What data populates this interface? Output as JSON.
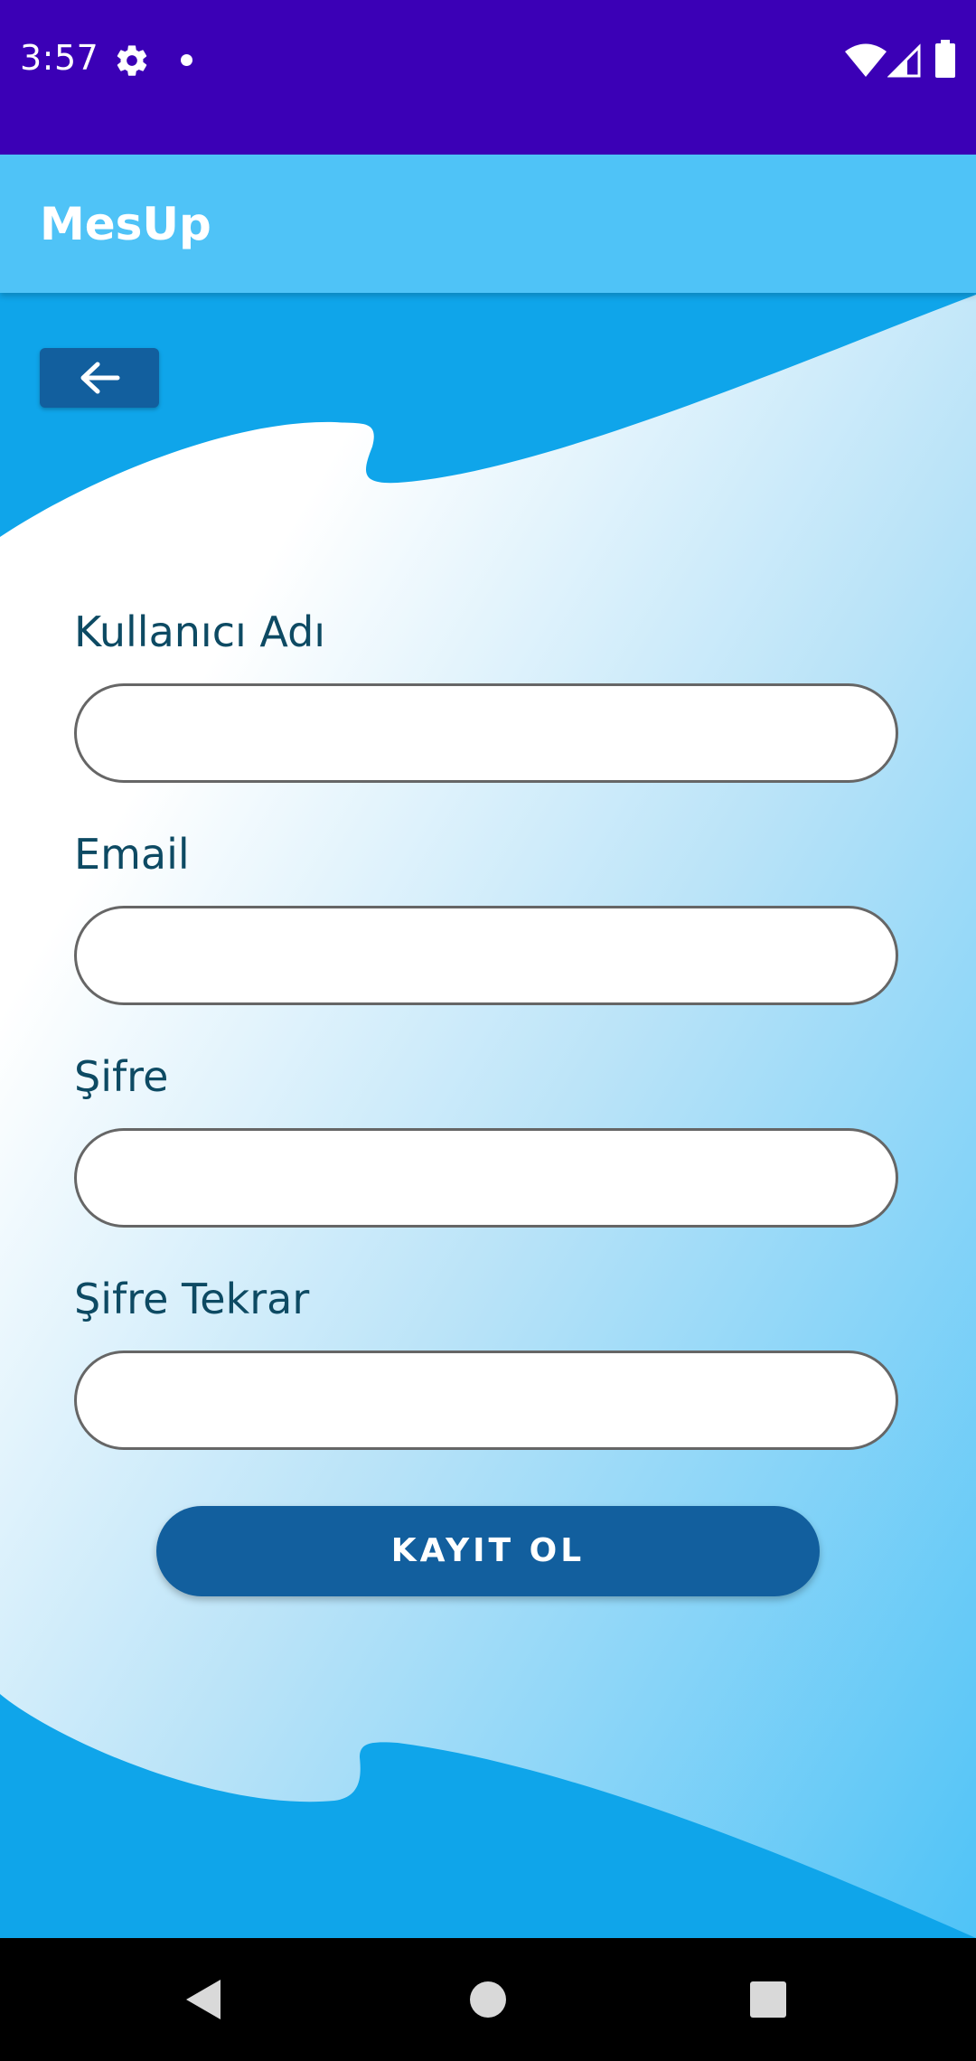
{
  "status_bar": {
    "time": "3:57"
  },
  "app_bar": {
    "title": "MesUp"
  },
  "form": {
    "username": {
      "label": "Kullanıcı Adı",
      "value": ""
    },
    "email": {
      "label": "Email",
      "value": ""
    },
    "password": {
      "label": "Şifre",
      "value": ""
    },
    "password_repeat": {
      "label": "Şifre Tekrar",
      "value": ""
    },
    "submit_label": "KAYIT OL"
  },
  "colors": {
    "status_bar": "#3b00b6",
    "app_bar": "#4fc3f7",
    "accent": "#125f9e",
    "wave": "#0fa5ea",
    "label_text": "#0d4a63"
  },
  "icons": {
    "back": "arrow-left-icon",
    "settings": "gear-icon",
    "wifi": "wifi-icon",
    "signal": "cell-signal-icon",
    "battery": "battery-icon"
  }
}
